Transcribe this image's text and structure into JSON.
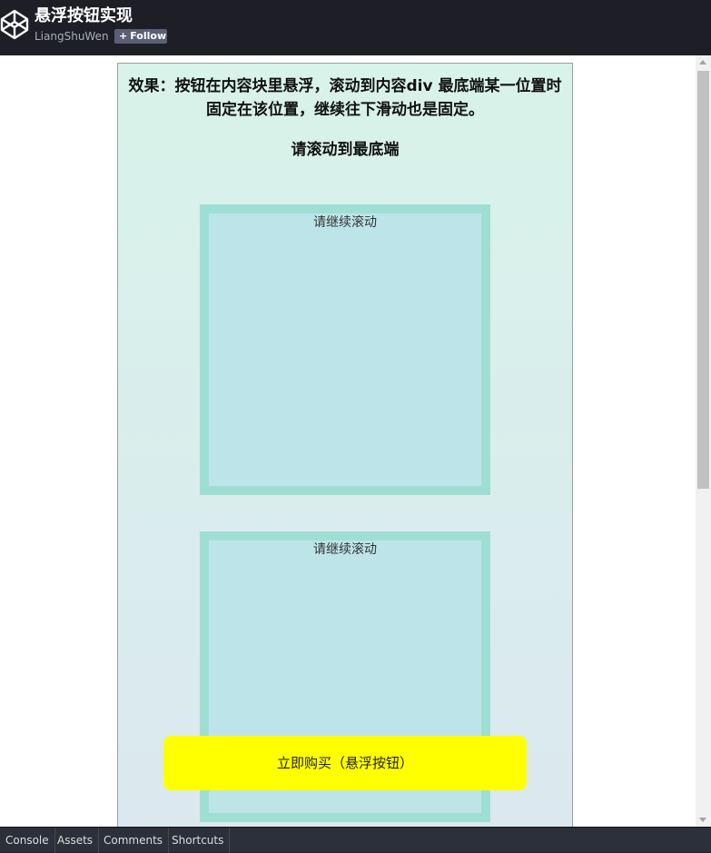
{
  "header": {
    "title": "悬浮按钮实现",
    "author": "LiangShuWen",
    "follow_plus": "+",
    "follow_label": "Follow",
    "logo_icon": "codepen-logo-icon"
  },
  "preview": {
    "heading": "效果：按钮在内容块里悬浮，滚动到内容div 最底端某一位置时固定在该位置，继续往下滑动也是固定。",
    "subheading": "请滚动到最底端",
    "blocks": [
      {
        "label": "请继续滚动"
      },
      {
        "label": "请继续滚动"
      }
    ],
    "float_button": "立即购买（悬浮按钮）",
    "colors": {
      "block_bg": "#bde5e9",
      "block_border": "#9fdfd3",
      "button_bg": "#ffff00"
    }
  },
  "bottombar": {
    "items": [
      "Console",
      "Assets",
      "Comments",
      "Shortcuts"
    ]
  }
}
